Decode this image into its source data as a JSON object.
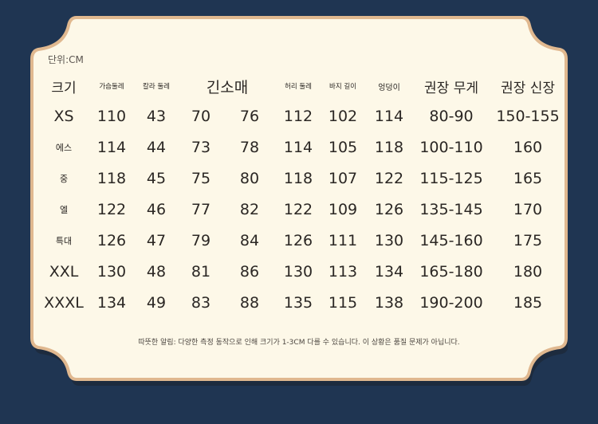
{
  "unit_label": "단위:CM",
  "headers": [
    "크기",
    "가슴둘레",
    "칼라 둘레",
    "긴소매",
    "허리 둘레",
    "바지 길이",
    "엉덩이",
    "권장 무게",
    "권장 신장"
  ],
  "rows": [
    {
      "size": "XS",
      "values": [
        "110",
        "43",
        "70",
        "76",
        "112",
        "102",
        "114",
        "80-90",
        "150-155"
      ]
    },
    {
      "size": "에스",
      "values": [
        "114",
        "44",
        "73",
        "78",
        "114",
        "105",
        "118",
        "100-110",
        "160"
      ]
    },
    {
      "size": "중",
      "values": [
        "118",
        "45",
        "75",
        "80",
        "118",
        "107",
        "122",
        "115-125",
        "165"
      ]
    },
    {
      "size": "엘",
      "values": [
        "122",
        "46",
        "77",
        "82",
        "122",
        "109",
        "126",
        "135-145",
        "170"
      ]
    },
    {
      "size": "특대",
      "values": [
        "126",
        "47",
        "79",
        "84",
        "126",
        "111",
        "130",
        "145-160",
        "175"
      ]
    },
    {
      "size": "XXL",
      "values": [
        "130",
        "48",
        "81",
        "86",
        "130",
        "113",
        "134",
        "165-180",
        "180"
      ]
    },
    {
      "size": "XXXL",
      "values": [
        "134",
        "49",
        "83",
        "88",
        "135",
        "115",
        "138",
        "190-200",
        "185"
      ]
    }
  ],
  "footnote": "따뜻한 알림: 다양한 측정 동작으로 인해 크기가 1-3CM 다를 수 있습니다. 이 상황은 품질 문제가 아닙니다.",
  "colors": {
    "background": "#1f3552",
    "card": "#fdf8e8",
    "border": "#e0b88f"
  }
}
